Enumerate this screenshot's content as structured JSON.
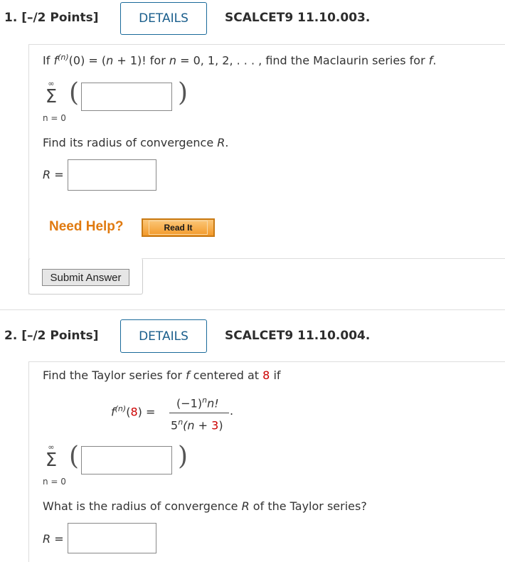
{
  "q1": {
    "header": "1.  [–/2 Points]",
    "details_label": "DETAILS",
    "course_code": "SCALCET9 11.10.003.",
    "line1_pre": "If ",
    "line1_f": "f",
    "line1_sup": "(n)",
    "line1_mid": "(0) = (",
    "line1_n": "n",
    "line1_mid2": " + 1)! for ",
    "line1_n2": "n",
    "line1_end": " = 0, 1, 2, . . . , find the Maclaurin series for ",
    "line1_f2": "f",
    "line1_dot": ".",
    "sigma_top": "∞",
    "sigma": "Σ",
    "sigma_bottom": "n = 0",
    "radius_prompt_pre": "Find its radius of convergence ",
    "radius_prompt_R": "R",
    "radius_prompt_dot": ".",
    "R_label": "R =",
    "need_help": "Need Help?",
    "read_it": "Read It",
    "submit": "Submit Answer"
  },
  "q2": {
    "header": "2.  [–/2 Points]",
    "details_label": "DETAILS",
    "course_code": "SCALCET9 11.10.004.",
    "line1_pre": "Find the Taylor series for ",
    "line1_f": "f",
    "line1_mid": " centered at ",
    "center": "8",
    "line1_end": " if",
    "formula_f": "f",
    "formula_sup": "(n)",
    "formula_open": "(",
    "formula_center": "8",
    "formula_close": ") =",
    "num": "(−1)",
    "num_sup": "n",
    "num_end": "n!",
    "den_5": "5",
    "den_sup": "n",
    "den_mid": "(n + ",
    "den_3": "3",
    "den_close": ")",
    "formula_dot": ".",
    "sigma_top": "∞",
    "sigma": "Σ",
    "sigma_bottom": "n = 0",
    "radius_prompt_pre": "What is the radius of convergence ",
    "radius_prompt_R": "R",
    "radius_prompt_end": " of the Taylor series?",
    "R_label": "R ="
  },
  "colors": {
    "accent": "#1a5e8c",
    "red": "#cc0000",
    "orange": "#e07a10"
  }
}
